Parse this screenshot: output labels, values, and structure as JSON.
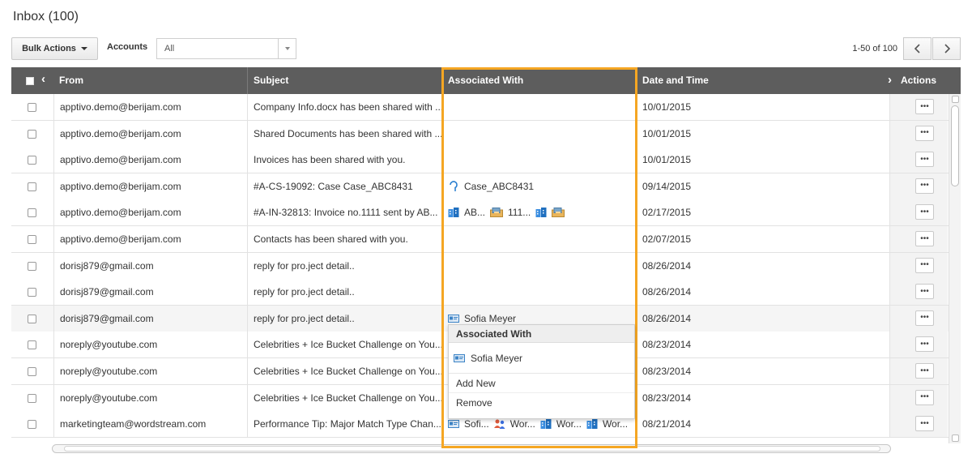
{
  "page": {
    "title": "Inbox (100)"
  },
  "toolbar": {
    "bulk_actions_label": "Bulk Actions",
    "accounts_label": "Accounts",
    "accounts_value": "All",
    "pager_text": "1-50 of 100"
  },
  "columns": {
    "from": "From",
    "subject": "Subject",
    "associated": "Associated With",
    "date": "Date and Time",
    "actions": "Actions"
  },
  "rows": [
    {
      "from": "apptivo.demo@berijam.com",
      "subject": "Company Info.docx has been shared with ...",
      "date": "10/01/2015",
      "assoc": []
    },
    {
      "from": "apptivo.demo@berijam.com",
      "subject": "Shared Documents has been shared with ...",
      "date": "10/01/2015",
      "assoc": []
    },
    {
      "from": "apptivo.demo@berijam.com",
      "subject": "Invoices has been shared with you.",
      "date": "10/01/2015",
      "assoc": []
    },
    {
      "from": "apptivo.demo@berijam.com",
      "subject": "#A-CS-19092: Case Case_ABC8431",
      "date": "09/14/2015",
      "assoc": [
        {
          "icon": "case-icon",
          "text": "Case_ABC8431"
        }
      ]
    },
    {
      "from": "apptivo.demo@berijam.com",
      "subject": "#A-IN-32813: Invoice no.1111 sent by AB...",
      "date": "02/17/2015",
      "assoc": [
        {
          "icon": "company-icon",
          "text": "AB..."
        },
        {
          "icon": "invoice-icon",
          "text": "111..."
        },
        {
          "icon": "company-icon",
          "text": ""
        },
        {
          "icon": "invoice-icon",
          "text": ""
        }
      ]
    },
    {
      "from": "apptivo.demo@berijam.com",
      "subject": "Contacts has been shared with you.",
      "date": "02/07/2015",
      "assoc": []
    },
    {
      "from": "dorisj879@gmail.com",
      "subject": "reply for pro.ject detail..",
      "date": "08/26/2014",
      "assoc": []
    },
    {
      "from": "dorisj879@gmail.com",
      "subject": "reply for pro.ject detail..",
      "date": "08/26/2014",
      "assoc": []
    },
    {
      "from": "dorisj879@gmail.com",
      "subject": "reply for pro.ject detail..",
      "date": "08/26/2014",
      "assoc": [
        {
          "icon": "contact-card-icon",
          "text": "Sofia Meyer"
        }
      ]
    },
    {
      "from": "noreply@youtube.com",
      "subject": "Celebrities + Ice Bucket Challenge on You...",
      "date": "08/23/2014",
      "assoc": []
    },
    {
      "from": "noreply@youtube.com",
      "subject": "Celebrities + Ice Bucket Challenge on You...",
      "date": "08/23/2014",
      "assoc": []
    },
    {
      "from": "noreply@youtube.com",
      "subject": "Celebrities + Ice Bucket Challenge on You...",
      "date": "08/23/2014",
      "assoc": []
    },
    {
      "from": "marketingteam@wordstream.com",
      "subject": "Performance Tip: Major Match Type Chan...",
      "date": "08/21/2014",
      "assoc": [
        {
          "icon": "contact-card-icon",
          "text": "Sofi..."
        },
        {
          "icon": "people-icon",
          "text": "Wor..."
        },
        {
          "icon": "company-icon",
          "text": "Wor..."
        },
        {
          "icon": "company-icon",
          "text": "Wor..."
        }
      ]
    }
  ],
  "popup": {
    "title": "Associated With",
    "item": "Sofia Meyer",
    "add_new": "Add New",
    "remove": "Remove"
  },
  "colors": {
    "header_bg": "#5d5d5d",
    "highlight": "#f5a623",
    "link_blue": "#2a7fd0"
  }
}
